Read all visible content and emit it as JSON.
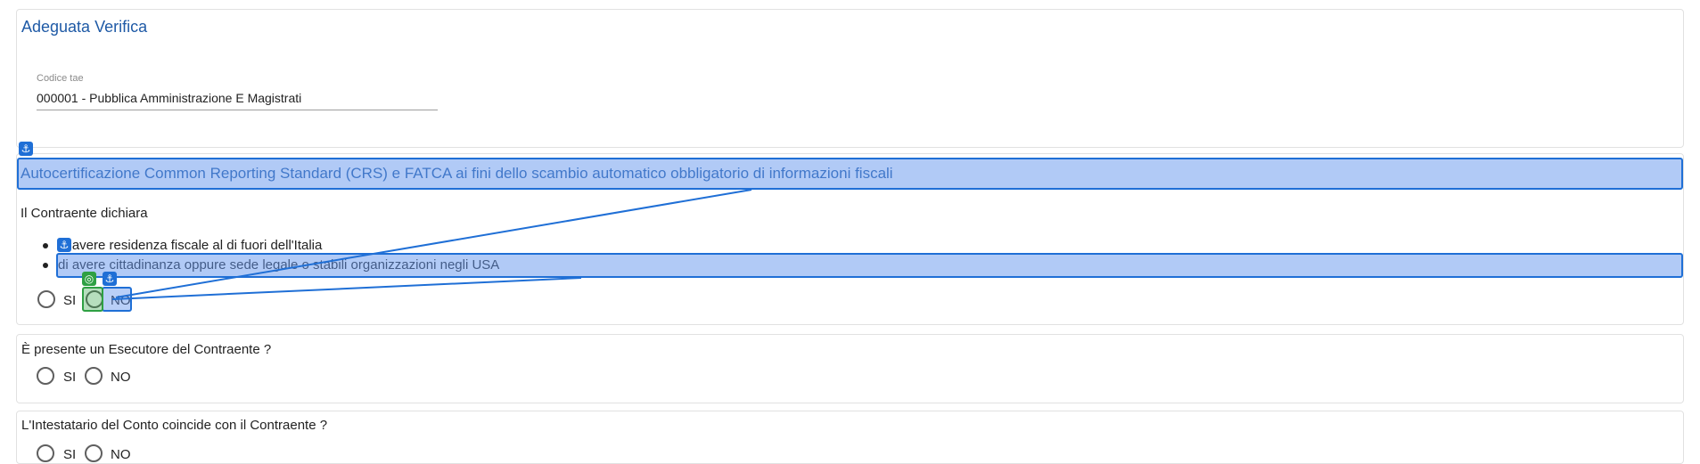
{
  "adeguata_verifica": {
    "title": "Adeguata Verifica",
    "codice_tae_label": "Codice tae",
    "codice_tae_value": "000001 - Pubblica Amministrazione E Magistrati"
  },
  "crs_fatca": {
    "title": "Autocertificazione Common Reporting Standard (CRS) e FATCA ai fini dello scambio automatico obbligatorio di informazioni fiscali",
    "intro": "Il Contraente dichiara",
    "items": [
      "di avere residenza fiscale al di fuori dell'Italia",
      "di avere cittadinanza oppure sede legale o stabili organizzazioni negli USA"
    ],
    "options": [
      "SI",
      "NO"
    ]
  },
  "esecutore": {
    "question": "È presente un Esecutore del Contraente ?",
    "options": [
      "SI",
      "NO"
    ]
  },
  "intestatario": {
    "question": "L'Intestatario del Conto coincide con il Contraente ?",
    "options": [
      "SI",
      "NO"
    ]
  },
  "overlay": {
    "anchor_glyph": "⚓",
    "target_glyph": "◎",
    "highlight_color": "#1f6fd6",
    "target_color": "#2ea043"
  }
}
